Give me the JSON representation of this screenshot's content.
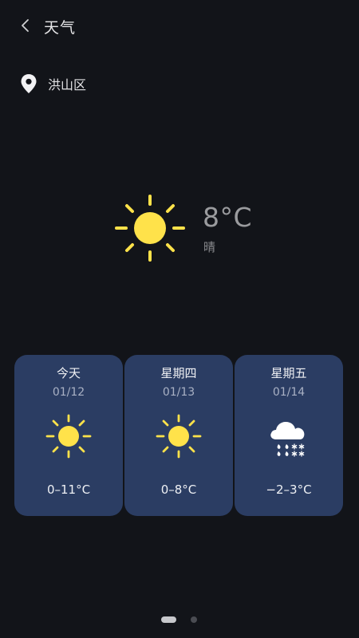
{
  "header": {
    "title": "天气",
    "back_icon": "chevron-left-icon"
  },
  "location": {
    "icon": "location-pin-icon",
    "name": "洪山区"
  },
  "current": {
    "icon": "sun-icon",
    "temperature": "8°C",
    "condition": "晴"
  },
  "forecast": [
    {
      "day": "今天",
      "date": "01/12",
      "icon": "sun-icon",
      "range": "0–11°C"
    },
    {
      "day": "星期四",
      "date": "01/13",
      "icon": "sun-icon",
      "range": "0–8°C"
    },
    {
      "day": "星期五",
      "date": "01/14",
      "icon": "rain-snow-icon",
      "range": "−2–3°C"
    }
  ],
  "pager": {
    "current_page": 1,
    "total_pages": 2
  },
  "colors": {
    "background": "#121419",
    "card": "#2b3d63",
    "sun": "#ffe24a"
  }
}
